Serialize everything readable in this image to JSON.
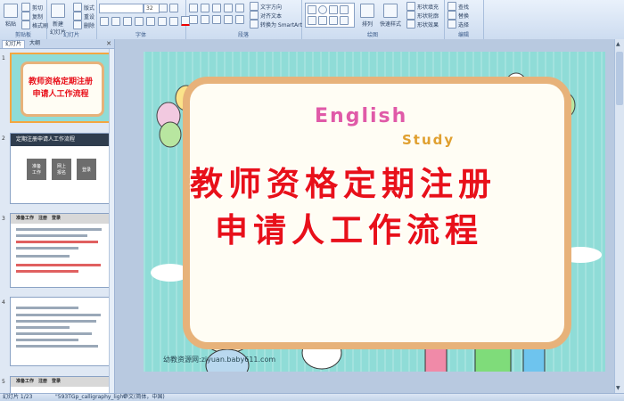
{
  "ribbon": {
    "groups": [
      {
        "name": "剪贴板"
      },
      {
        "name": "幻灯片"
      },
      {
        "name": "字体"
      },
      {
        "name": "段落"
      },
      {
        "name": "绘图"
      },
      {
        "name": "编辑"
      }
    ],
    "paste_label": "粘贴",
    "cut_label": "剪切",
    "copy_label": "复制",
    "format_painter_label": "格式刷",
    "new_slide_label": "新建\n幻灯片",
    "layout_label": "版式",
    "reset_label": "重设",
    "delete_label": "删除",
    "font_name": "",
    "font_size": "32",
    "text_direction_label": "文字方向",
    "align_text_label": "对齐文本",
    "smartart_label": "转换为 SmartArt",
    "arrange_label": "排列",
    "quick_styles_label": "快速样式",
    "shape_fill_label": "形状填充",
    "shape_outline_label": "形状轮廓",
    "shape_effects_label": "形状效果",
    "find_label": "查找",
    "replace_label": "替换",
    "select_label": "选择"
  },
  "leftpane": {
    "tab_slides": "幻灯片",
    "tab_outline": "大纲",
    "thumbs": [
      {
        "num": "1"
      },
      {
        "num": "2",
        "title": "定期注册申请人工作流程",
        "box1": "准备\n工作",
        "box2": "网上\n报名",
        "box3": "登录"
      },
      {
        "num": "3",
        "head": "准备工作　注册　登录"
      },
      {
        "num": "4"
      },
      {
        "num": "5",
        "head": "准备工作　注册　登录"
      }
    ]
  },
  "slide": {
    "english": "English",
    "study": "Study",
    "title_line1": "教师资格定期注册",
    "title_line2": "申请人工作流程",
    "footer": "幼教资源网:ziyuan.baby611.com"
  },
  "status": {
    "slide_info": "幻灯片 1/23",
    "theme": "\"593TGp_calligraphy_light\"",
    "language": "中文(简体，中国)"
  },
  "colors": {
    "title_red": "#e8101a",
    "slide_bg": "#8fdcd7",
    "frame": "#e7b27a",
    "ribbon_bg": "#dce7f5",
    "selected_border": "#f4a640"
  }
}
